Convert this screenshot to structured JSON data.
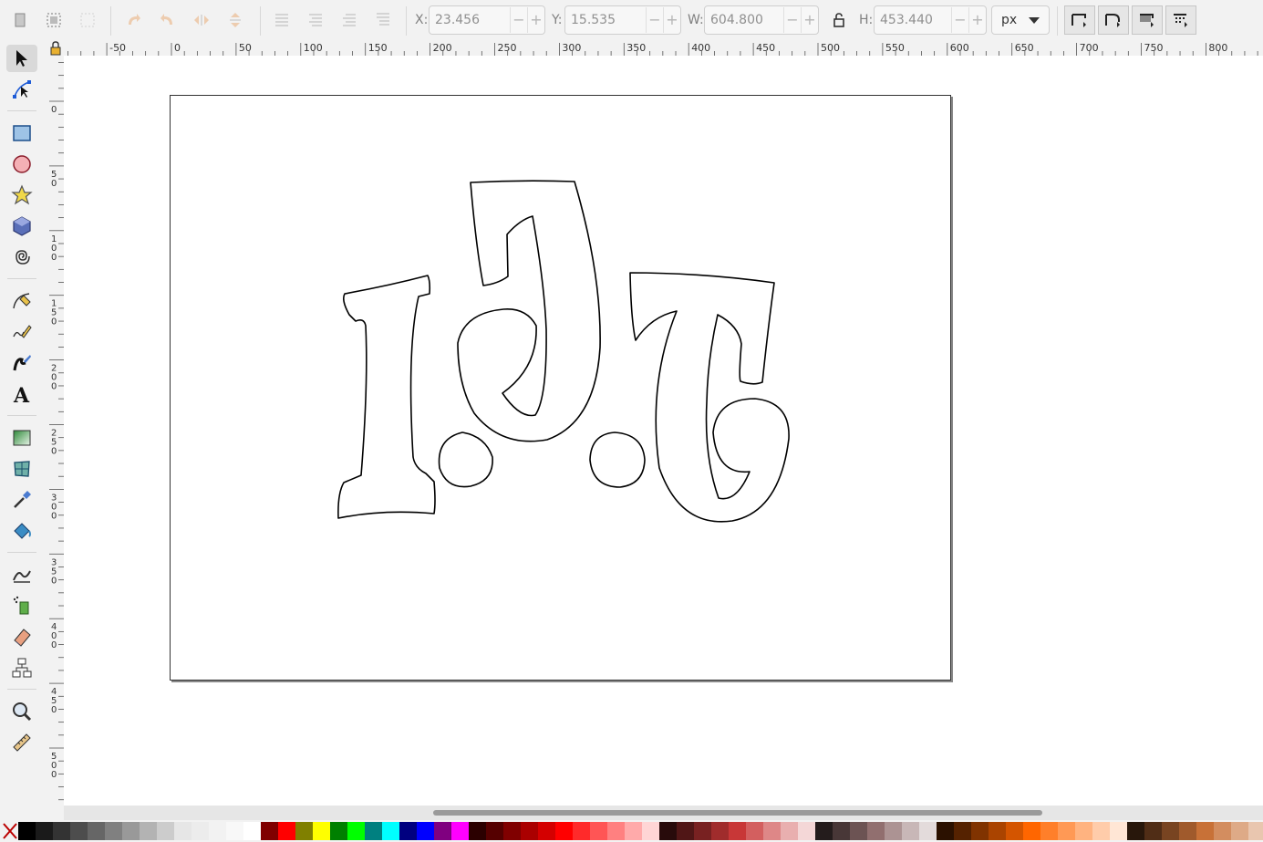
{
  "toolbar": {
    "x_label": "X:",
    "x_value": "23.456",
    "y_label": "Y:",
    "y_value": "15.535",
    "w_label": "W:",
    "w_value": "604.800",
    "h_label": "H:",
    "h_value": "453.440",
    "unit": "px",
    "minus": "−",
    "plus": "+"
  },
  "ruler": {
    "h_ticks": [
      "-50",
      "0",
      "50",
      "100",
      "150",
      "200",
      "250",
      "300",
      "350",
      "400",
      "450",
      "500",
      "550",
      "600",
      "650",
      "700",
      "750",
      "800"
    ],
    "v_ticks": [
      "0",
      "50",
      "100",
      "150",
      "200",
      "250",
      "300",
      "350",
      "400",
      "450",
      "500"
    ]
  },
  "tools": [
    "selector-arrow-icon",
    "node-editor-icon",
    "rectangle-icon",
    "ellipse-icon",
    "star-icon",
    "box3d-icon",
    "spiral-icon",
    "bezier-pen-icon",
    "pencil-icon",
    "calligraphy-icon",
    "text-icon",
    "gradient-icon",
    "mesh-icon",
    "dropper-icon",
    "paint-bucket-icon",
    "tweak-icon",
    "spray-icon",
    "eraser-icon",
    "connector-icon",
    "zoom-icon",
    "measure-icon"
  ],
  "palette": [
    "#000000",
    "#1a1a1a",
    "#333333",
    "#4d4d4d",
    "#666666",
    "#808080",
    "#999999",
    "#b3b3b3",
    "#cccccc",
    "#e6e6e6",
    "#ececec",
    "#f2f2f2",
    "#f8f8f8",
    "#ffffff",
    "#800000",
    "#ff0000",
    "#808000",
    "#ffff00",
    "#008000",
    "#00ff00",
    "#008080",
    "#00ffff",
    "#000080",
    "#0000ff",
    "#800080",
    "#ff00ff",
    "#2b0000",
    "#550000",
    "#800000",
    "#aa0000",
    "#d40000",
    "#ff0000",
    "#ff2a2a",
    "#ff5555",
    "#ff8080",
    "#ffaaaa",
    "#ffd5d5",
    "#280b0b",
    "#501616",
    "#782121",
    "#a02c2c",
    "#c83737",
    "#d35f5f",
    "#de8787",
    "#e9afaf",
    "#f4d7d7",
    "#241c1c",
    "#483737",
    "#6c5353",
    "#916f6f",
    "#ac9393",
    "#c8b7b7",
    "#e3dbdb",
    "#2b1100",
    "#552200",
    "#803300",
    "#aa4400",
    "#d45500",
    "#ff6600",
    "#ff7f2a",
    "#ff9955",
    "#ffb380",
    "#ffccaa",
    "#ffe6d5",
    "#28170b",
    "#502d16",
    "#784421",
    "#a05a2c",
    "#c87137",
    "#d38d5f",
    "#deaa87",
    "#e9c6af"
  ],
  "colors": {
    "accent": "#333333",
    "page_border": "#333333",
    "outline": "#000000"
  }
}
